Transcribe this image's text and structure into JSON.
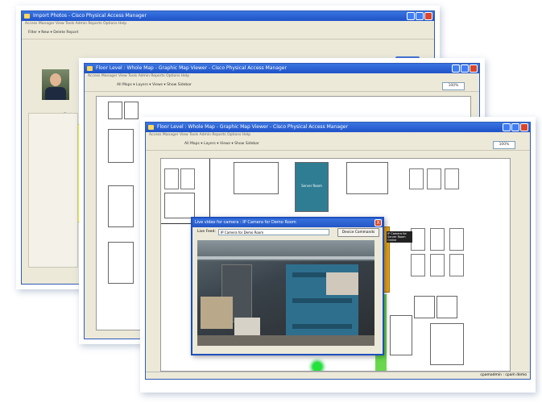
{
  "windows": {
    "back": {
      "title": "Import Photos - Cisco Physical Access Manager",
      "menu": "Access Manager  View  Tools  Admin  Reports  Options  Help",
      "toolbar": "Filter  ▾   New  ▾  Delete   Report",
      "photo_label": "Photo"
    },
    "middle": {
      "title": "Floor Level : Whole Map - Graphic Map Viewer - Cisco Physical Access Manager",
      "menu": "Access Manager  View  Tools  Admin  Reports  Options  Help",
      "toolbar": "All Maps  ▾   Layers  ▾   Views  ▾   Show Sidebar",
      "zoom": "100%"
    },
    "front": {
      "title": "Floor Level : Whole Map - Graphic Map Viewer - Cisco Physical Access Manager",
      "menu": "Access Manager  View  Tools  Admin  Reports  Options  Help",
      "toolbar": "All Maps  ▾   Layers  ▾   Views  ▾   Show Sidebar",
      "zoom": "100%",
      "status": "cpamadmin : cpam demo",
      "room_label": "Server Room",
      "tooltip": "IP Camera for Server Room Online"
    }
  },
  "popup": {
    "title": "Live video for camera : IP Camera for Demo Room",
    "feed_label": "Live Feed:",
    "feed_value": "IP Camera for Demo Room",
    "device_button": "Device Commands",
    "close": "X"
  },
  "colors": {
    "titlebar": "#2456c6",
    "teal_room": "#2f7d93",
    "camera_online": "#23e33b",
    "door_yellow": "#e9a51c",
    "highlight_yellow": "#ffff00"
  }
}
